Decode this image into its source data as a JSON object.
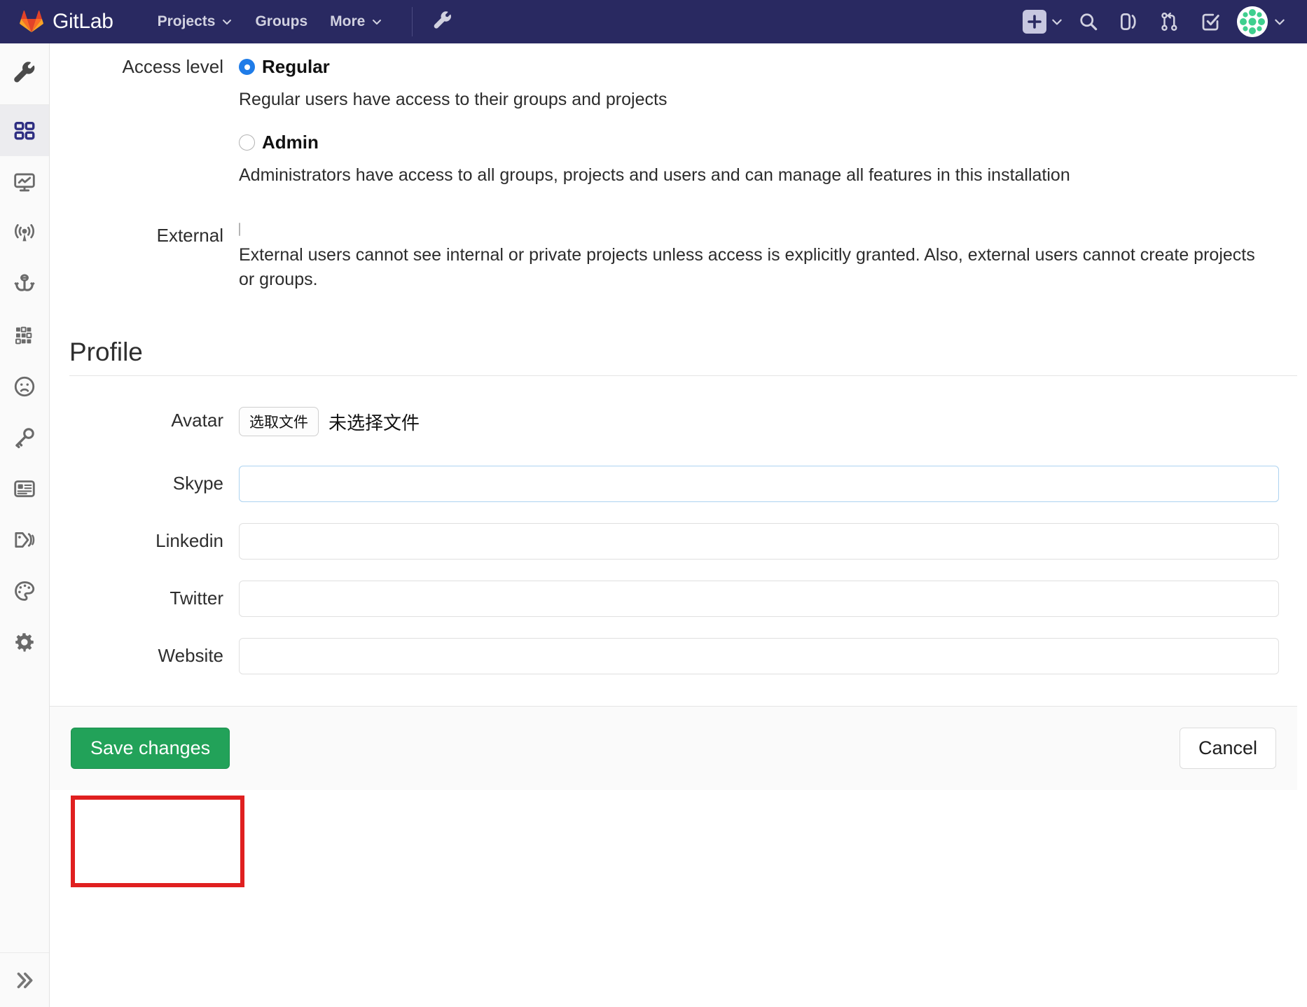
{
  "navbar": {
    "brand": "GitLab",
    "links": [
      {
        "label": "Projects",
        "has_caret": true
      },
      {
        "label": "Groups",
        "has_caret": false
      },
      {
        "label": "More",
        "has_caret": true
      }
    ],
    "admin_icon": "wrench-icon",
    "right_icons": [
      "plus-icon",
      "search-icon",
      "issues-icon",
      "merge-requests-icon",
      "todos-icon",
      "user-avatar"
    ],
    "bg_color": "#292961"
  },
  "sidebar": {
    "top_icon": "wrench-icon",
    "items": [
      {
        "name": "overview",
        "icon": "dashboard-icon",
        "active": true
      },
      {
        "name": "monitoring",
        "icon": "monitor-icon",
        "active": false
      },
      {
        "name": "system-hooks",
        "icon": "broadcast-icon",
        "active": false
      },
      {
        "name": "applications",
        "icon": "anchor-icon",
        "active": false
      },
      {
        "name": "abuse-reports",
        "icon": "grid-apps-icon",
        "active": false
      },
      {
        "name": "sad-face",
        "icon": "sad-face-icon",
        "active": false
      },
      {
        "name": "deploy-keys",
        "icon": "key-icon",
        "active": false
      },
      {
        "name": "service-templates",
        "icon": "template-icon",
        "active": false
      },
      {
        "name": "labels",
        "icon": "labels-icon",
        "active": false
      },
      {
        "name": "appearance",
        "icon": "palette-icon",
        "active": false
      },
      {
        "name": "settings",
        "icon": "gear-icon",
        "active": false
      }
    ],
    "collapse_toggle": "chevron-double-right-icon"
  },
  "form": {
    "access_level": {
      "label": "Access level",
      "options": [
        {
          "value": "regular",
          "label": "Regular",
          "selected": true,
          "description": "Regular users have access to their groups and projects"
        },
        {
          "value": "admin",
          "label": "Admin",
          "selected": false,
          "description": "Administrators have access to all groups, projects and users and can manage all features in this installation"
        }
      ]
    },
    "external": {
      "label": "External",
      "checked": false,
      "description": "External users cannot see internal or private projects unless access is explicitly granted. Also, external users cannot create projects or groups."
    },
    "profile_section": {
      "heading": "Profile",
      "avatar": {
        "label": "Avatar",
        "button_label": "选取文件",
        "status_text": "未选择文件"
      },
      "fields": [
        {
          "label": "Skype",
          "value": "",
          "placeholder": "",
          "focused": true
        },
        {
          "label": "Linkedin",
          "value": "",
          "placeholder": "",
          "focused": false
        },
        {
          "label": "Twitter",
          "value": "",
          "placeholder": "",
          "focused": false
        },
        {
          "label": "Website",
          "value": "",
          "placeholder": "",
          "focused": false
        }
      ]
    },
    "actions": {
      "save_label": "Save changes",
      "cancel_label": "Cancel",
      "save_color": "#22a259",
      "highlight_color": "#e02020"
    }
  }
}
